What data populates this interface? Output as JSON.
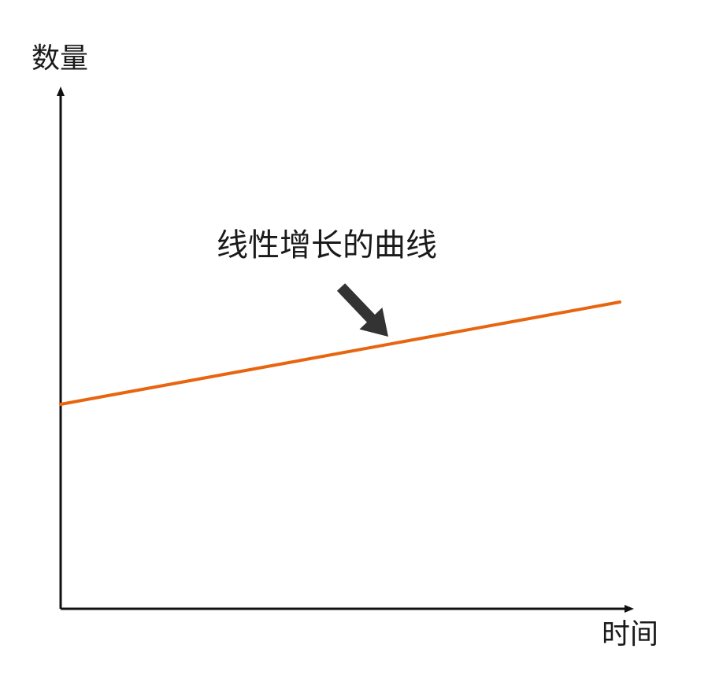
{
  "chart_data": {
    "type": "line",
    "title": "",
    "xlabel": "时间",
    "ylabel": "数量",
    "xlim": [
      0,
      10
    ],
    "ylim": [
      0,
      10
    ],
    "grid": false,
    "legend": "none",
    "series": [
      {
        "x": [
          0,
          10
        ],
        "y": [
          4.0,
          6.0
        ],
        "color": "#e8650f"
      }
    ],
    "annotations": [
      {
        "text": "线性增长的曲线",
        "arrow_target": {
          "x": 6.0,
          "y": 5.2
        }
      }
    ]
  },
  "colors": {
    "axis": "#111111",
    "line": "#e8650f",
    "arrow": "#333333"
  }
}
